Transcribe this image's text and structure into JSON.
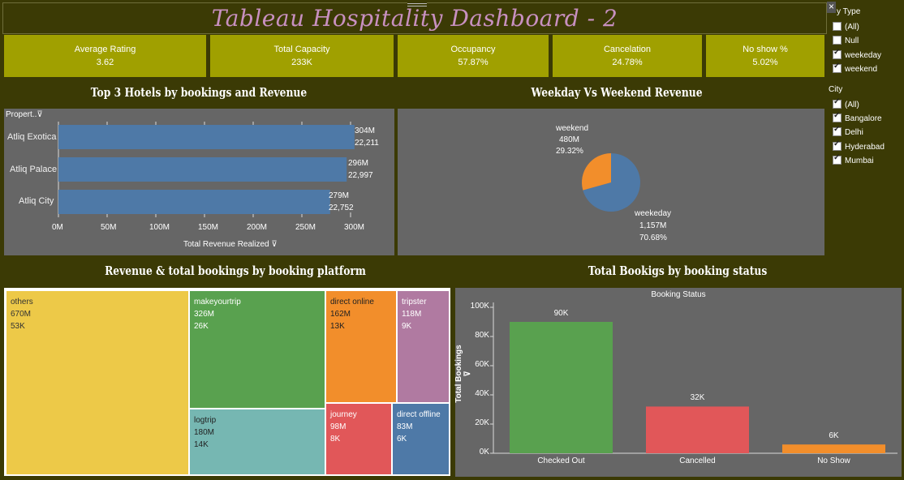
{
  "title": "Tableau Hospitality Dashboard  - 2",
  "kpis": [
    {
      "label": "Average Rating",
      "value": "3.62"
    },
    {
      "label": "Total Capacity",
      "value": "233K"
    },
    {
      "label": "Occupancy",
      "value": "57.87%"
    },
    {
      "label": "Cancelation",
      "value": "24.78%"
    },
    {
      "label": "No show %",
      "value": "5.02%"
    }
  ],
  "filters": {
    "day_type": {
      "title": "y Type",
      "items": [
        {
          "label": "(All)",
          "checked": false
        },
        {
          "label": "Null",
          "checked": false
        },
        {
          "label": "weekeday",
          "checked": true
        },
        {
          "label": "weekend",
          "checked": true
        }
      ]
    },
    "city": {
      "title": "City",
      "items": [
        {
          "label": "(All)",
          "checked": true
        },
        {
          "label": "Bangalore",
          "checked": true
        },
        {
          "label": "Delhi",
          "checked": true
        },
        {
          "label": "Hyderabad",
          "checked": true
        },
        {
          "label": "Mumbai",
          "checked": true
        }
      ]
    },
    "close_glyph": "×"
  },
  "top_hotels": {
    "section_title": "Top 3 Hotels  by bookings and Revenue",
    "header_label": "Propert..",
    "sort_glyph": "⊽",
    "x_axis_title": "Total Revenue Realized",
    "x_ticks": [
      "0M",
      "50M",
      "100M",
      "150M",
      "200M",
      "250M",
      "300M"
    ],
    "rows": [
      {
        "name": "Atliq Exotica",
        "revenue_label": "304M",
        "bookings_label": "22,211"
      },
      {
        "name": "Atliq Palace",
        "revenue_label": "296M",
        "bookings_label": "22,997"
      },
      {
        "name": "Atliq City",
        "revenue_label": "279M",
        "bookings_label": "22,752"
      }
    ]
  },
  "weekday_weekend": {
    "section_title": "Weekday Vs Weekend Revenue",
    "weekend": {
      "name": "weekend",
      "value": "480M",
      "pct": "29.32%"
    },
    "weekday": {
      "name": "weekeday",
      "value": "1,157M",
      "pct": "70.68%"
    }
  },
  "treemap": {
    "section_title": "Revenue & total bookings by booking platform",
    "cells": [
      {
        "name": "others",
        "revenue": "670M",
        "bookings": "53K",
        "color": "#edc948"
      },
      {
        "name": "makeyourtrip",
        "revenue": "326M",
        "bookings": "26K",
        "color": "#59a14f"
      },
      {
        "name": "logtrip",
        "revenue": "180M",
        "bookings": "14K",
        "color": "#76b7b2"
      },
      {
        "name": "direct online",
        "revenue": "162M",
        "bookings": "13K",
        "color": "#f28e2b"
      },
      {
        "name": "tripster",
        "revenue": "118M",
        "bookings": "9K",
        "color": "#b07aa1"
      },
      {
        "name": "journey",
        "revenue": "98M",
        "bookings": "8K",
        "color": "#e15759"
      },
      {
        "name": "direct offline",
        "revenue": "83M",
        "bookings": "6K",
        "color": "#4e79a7"
      }
    ]
  },
  "booking_status": {
    "section_title": "Total Bookigs by booking status",
    "chart_title": "Booking Status",
    "y_axis_title": "Total Bookings",
    "y_ticks": [
      "100K",
      "80K",
      "60K",
      "40K",
      "20K",
      "0K"
    ],
    "sort_glyph": "⊽"
  },
  "chart_data": [
    {
      "type": "bar",
      "orientation": "horizontal",
      "title": "Top 3 Hotels  by bookings and Revenue",
      "xlabel": "Total Revenue Realized",
      "ylabel": "Propert..",
      "categories": [
        "Atliq Exotica",
        "Atliq Palace",
        "Atliq City"
      ],
      "series": [
        {
          "values": [
            304,
            296,
            279
          ]
        },
        {
          "values": [
            22211,
            22997,
            22752
          ]
        }
      ],
      "xlim": [
        0,
        330
      ],
      "color": "#4e79a7"
    },
    {
      "type": "pie",
      "title": "Weekday Vs Weekend Revenue",
      "categories": [
        "weekeday",
        "weekend"
      ],
      "values": [
        1157,
        480
      ],
      "percents": [
        70.68,
        29.32
      ],
      "colors": [
        "#4e79a7",
        "#f28e2b"
      ]
    },
    {
      "type": "bar",
      "title": "Booking Status",
      "ylabel": "Total Bookings",
      "categories": [
        "Checked Out",
        "Cancelled",
        "No Show"
      ],
      "values": [
        90,
        32,
        6
      ],
      "value_labels": [
        "90K",
        "32K",
        "6K"
      ],
      "ylim": [
        0,
        100
      ],
      "colors": [
        "#59a14f",
        "#e15759",
        "#f28e2b"
      ]
    }
  ]
}
